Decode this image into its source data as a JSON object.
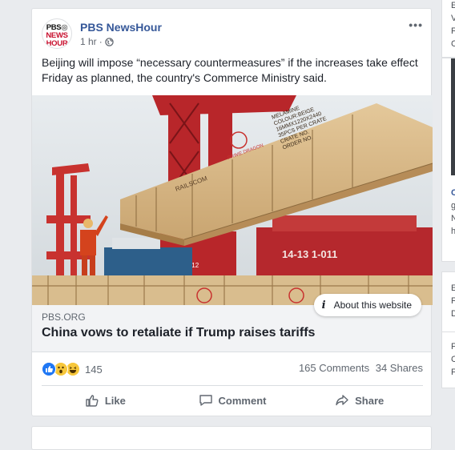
{
  "post": {
    "page_name": "PBS NewsHour",
    "logo": {
      "line1": "PBS◎",
      "line2": "NEWS",
      "line3": "HOUR"
    },
    "time": "1 hr",
    "separator": "·",
    "privacy_icon": "globe-icon",
    "more_label": "•••",
    "text": "Beijing will impose “necessary countermeasures” if the increases take effect Friday as planned, the country's Commerce Ministry said.",
    "photo_text": {
      "crate_stencil": "MELAMINE\nCOLOUR:BEIGE\n16MMX1220X2440\n35PCS PER CRATE\nCRATE NO.\nORDER NO.",
      "crate_side": "RAILSCOM",
      "brand": "PRIME DRAGON",
      "crane_number": "14-13 1-011",
      "crane_small": "14-13 1-012"
    },
    "link": {
      "domain": "PBS.ORG",
      "headline": "China vows to retaliate if Trump raises tariffs",
      "about_label": "About this website"
    },
    "reactions": {
      "icons": [
        "like-reaction-icon",
        "wow-reaction-icon",
        "haha-reaction-icon"
      ],
      "count": "145"
    },
    "comments": "165 Comments",
    "shares": "34 Shares",
    "actions": {
      "like": "Like",
      "comment": "Comment",
      "share": "Share"
    }
  },
  "sidebar_fragments": {
    "box1": [
      "E",
      "V",
      "F",
      "C"
    ],
    "box2": [
      "C",
      "g",
      "N",
      "h"
    ],
    "box3": [
      "E",
      "F",
      "D"
    ],
    "box4": [
      "F",
      "C",
      "F"
    ]
  },
  "colors": {
    "brand_link": "#365899",
    "like_blue": "#2078f4",
    "background": "#e9ebee"
  }
}
